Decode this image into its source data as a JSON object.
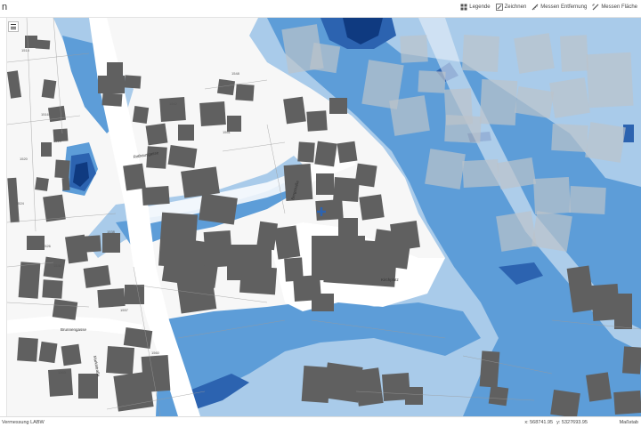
{
  "app": {
    "letter": "n"
  },
  "toolbar": {
    "items": [
      {
        "label": "Legende",
        "icon": "legend-icon"
      },
      {
        "label": "Zeichnen",
        "icon": "pencil-icon"
      },
      {
        "label": "Messen Entfernung",
        "icon": "ruler-icon"
      },
      {
        "label": "Messen Fläche",
        "icon": "area-icon"
      }
    ]
  },
  "map": {
    "colors": {
      "flood_shallow": "#a9cbea",
      "flood_medium": "#5d9dd8",
      "flood_deep": "#2c63b0",
      "flood_very_deep": "#0f3a80",
      "building": "#606060",
      "building_flooded": "#bcc3cb",
      "road": "#ffffff",
      "parcel_line": "#9a9a9a"
    },
    "street_labels": [
      "Kirchplatz",
      "Brunnengasse",
      "Bergstraße",
      "Rathausgasse",
      "Marktstraße"
    ],
    "parcel_labels": [
      "1514",
      "1516",
      "1519",
      "1520",
      "1524",
      "1526",
      "1530",
      "1538",
      "1542",
      "1548",
      "1551",
      "1557",
      "1560",
      "1563"
    ]
  },
  "bottombar": {
    "attribution": "Vermessung LABW",
    "coords": {
      "x": "x: 568741.95",
      "y": "y: 5327693.95"
    },
    "scale": "Maßstab"
  }
}
